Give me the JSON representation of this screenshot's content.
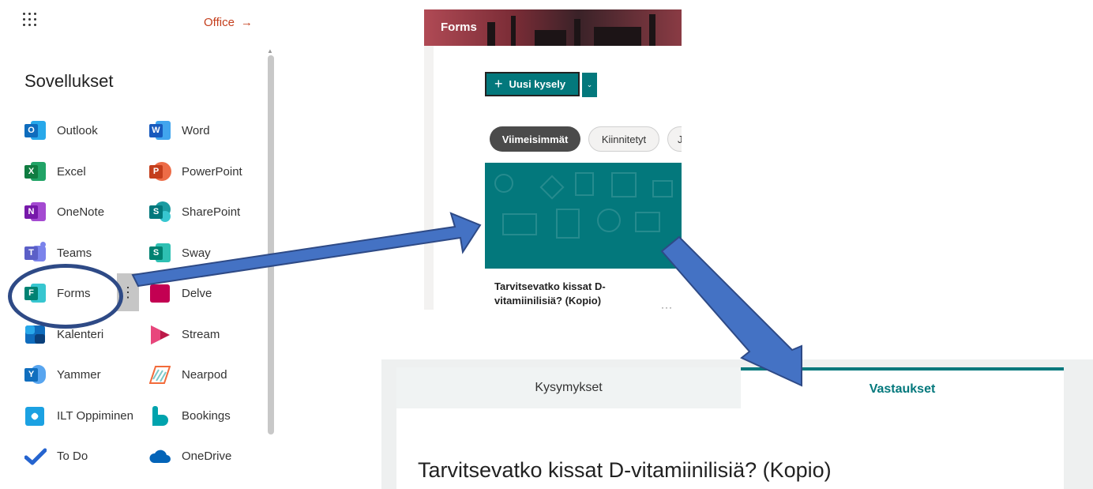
{
  "launcher": {
    "office_link": "Office",
    "office_arrow": "→",
    "title": "Sovellukset",
    "apps_left": [
      {
        "label": "Outlook",
        "letter": "O",
        "color": "#0f6cbd"
      },
      {
        "label": "Excel",
        "letter": "X",
        "color": "#107c41"
      },
      {
        "label": "OneNote",
        "letter": "N",
        "color": "#7719aa"
      },
      {
        "label": "Teams",
        "letter": "T",
        "color": "#5b5fc7"
      },
      {
        "label": "Forms",
        "letter": "F",
        "color": "#008272"
      },
      {
        "label": "Kalenteri",
        "letter": "",
        "color": "#0f6cbd"
      },
      {
        "label": "Yammer",
        "letter": "Y",
        "color": "#106ebe"
      },
      {
        "label": "ILT Oppiminen",
        "letter": "",
        "color": "#1ba1e2"
      },
      {
        "label": "To Do",
        "letter": "",
        "color": "#2564cf"
      }
    ],
    "apps_right": [
      {
        "label": "Word",
        "letter": "W",
        "color": "#185abd"
      },
      {
        "label": "PowerPoint",
        "letter": "P",
        "color": "#c43e1c"
      },
      {
        "label": "SharePoint",
        "letter": "S",
        "color": "#03787c"
      },
      {
        "label": "Sway",
        "letter": "S",
        "color": "#008272"
      },
      {
        "label": "Delve",
        "letter": "",
        "color": "#c30052"
      },
      {
        "label": "Stream",
        "letter": "",
        "color": "#bc1948"
      },
      {
        "label": "Nearpod",
        "letter": "",
        "color": "#f26b3a"
      },
      {
        "label": "Bookings",
        "letter": "B",
        "color": "#00a3ad"
      },
      {
        "label": "OneDrive",
        "letter": "",
        "color": "#0364b8"
      }
    ],
    "more_dots": "⋮"
  },
  "forms": {
    "header_title": "Forms",
    "new_button": "Uusi kysely",
    "new_plus": "+",
    "dropdown": "⌄",
    "pills": [
      "Viimeisimmät",
      "Kiinnitetyt",
      "J"
    ],
    "card_title": "Tarvitsevatko kissat D-vitamiinilisiä? (Kopio)",
    "card_more": "···"
  },
  "form_view": {
    "tab_questions": "Kysymykset",
    "tab_answers": "Vastaukset",
    "title": "Tarvitsevatko kissat D-vitamiinilisiä? (Kopio)"
  },
  "colors": {
    "teal": "#03787c",
    "arrow_fill": "#4472c4",
    "arrow_stroke": "#2e4a86",
    "ring": "#2e4a86"
  }
}
